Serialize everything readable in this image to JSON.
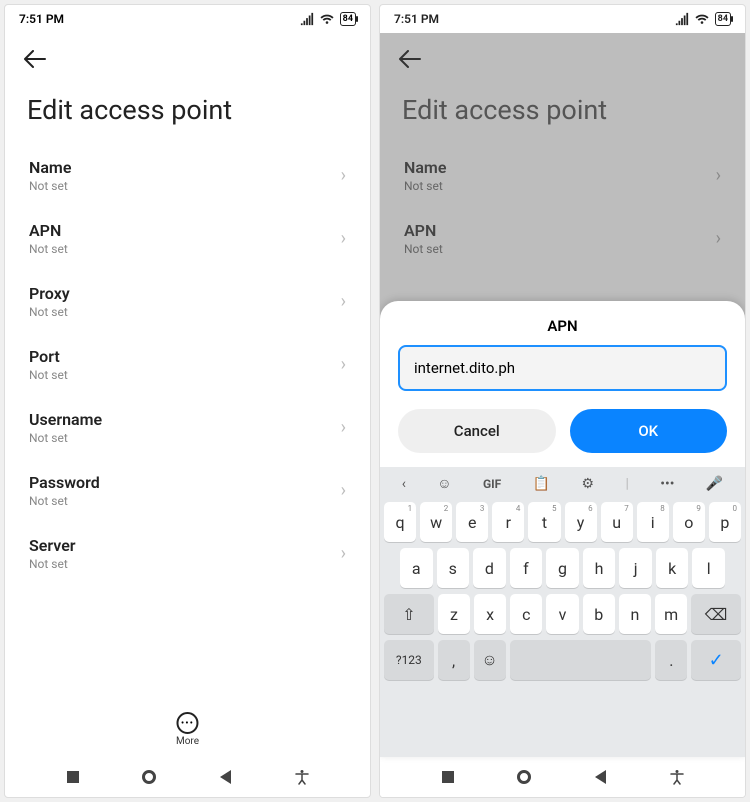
{
  "status": {
    "time": "7:51 PM",
    "battery": "84"
  },
  "page_title": "Edit access point",
  "not_set": "Not set",
  "settings_left": [
    {
      "label": "Name",
      "value": "Not set"
    },
    {
      "label": "APN",
      "value": "Not set"
    },
    {
      "label": "Proxy",
      "value": "Not set"
    },
    {
      "label": "Port",
      "value": "Not set"
    },
    {
      "label": "Username",
      "value": "Not set"
    },
    {
      "label": "Password",
      "value": "Not set"
    },
    {
      "label": "Server",
      "value": "Not set"
    }
  ],
  "settings_right": [
    {
      "label": "Name",
      "value": "Not set"
    },
    {
      "label": "APN",
      "value": "Not set"
    }
  ],
  "more_label": "More",
  "dialog": {
    "title": "APN",
    "input_value": "internet.dito.ph",
    "cancel": "Cancel",
    "ok": "OK"
  },
  "keyboard": {
    "toolbar": {
      "gif": "GIF"
    },
    "row1": [
      {
        "k": "q",
        "n": "1"
      },
      {
        "k": "w",
        "n": "2"
      },
      {
        "k": "e",
        "n": "3"
      },
      {
        "k": "r",
        "n": "4"
      },
      {
        "k": "t",
        "n": "5"
      },
      {
        "k": "y",
        "n": "6"
      },
      {
        "k": "u",
        "n": "7"
      },
      {
        "k": "i",
        "n": "8"
      },
      {
        "k": "o",
        "n": "9"
      },
      {
        "k": "p",
        "n": "0"
      }
    ],
    "row2": [
      "a",
      "s",
      "d",
      "f",
      "g",
      "h",
      "j",
      "k",
      "l"
    ],
    "row3": [
      "z",
      "x",
      "c",
      "v",
      "b",
      "n",
      "m"
    ],
    "symkey": "?123",
    "comma": ",",
    "period": "."
  }
}
